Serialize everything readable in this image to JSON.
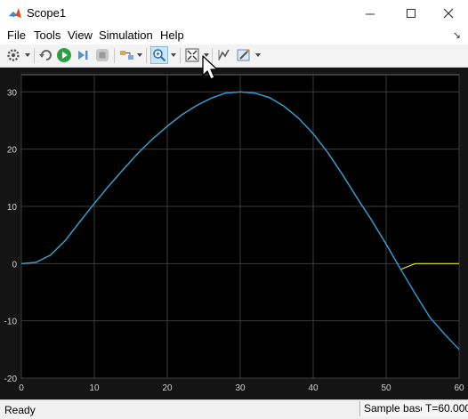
{
  "window": {
    "title": "Scope1"
  },
  "menu": [
    "File",
    "Tools",
    "View",
    "Simulation",
    "Help"
  ],
  "toolbar_icons": [
    "gear-icon",
    "restore-icon",
    "run-icon",
    "step-forward-icon",
    "stop-icon",
    "highlight-block-icon",
    "zoom-in-icon",
    "zoom-fit-icon",
    "cursor-measure-icon",
    "style-icon"
  ],
  "status": {
    "ready": "Ready",
    "sample_mode": "Sample based",
    "time": "T=60.000"
  },
  "colors": {
    "plot_bg": "#000000",
    "frame_bg": "#141414",
    "grid": "#3c3c3c",
    "axis_text": "#d0d0d0",
    "signal_blue": "#2f9bd6",
    "signal_yellow": "#e6e619"
  },
  "chart_data": {
    "type": "line",
    "xlim": [
      0,
      60
    ],
    "ylim": [
      -20,
      33
    ],
    "xticks": [
      0,
      10,
      20,
      30,
      40,
      50,
      60
    ],
    "yticks": [
      -20,
      -10,
      0,
      10,
      20,
      30
    ],
    "grid": true,
    "series": [
      {
        "color": "#2f9bd6",
        "x": [
          0,
          2,
          4,
          6,
          8,
          10,
          12,
          14,
          16,
          18,
          20,
          22,
          24,
          26,
          28,
          30,
          32,
          34,
          36,
          38,
          40,
          42,
          44,
          46,
          48,
          50,
          52,
          54,
          56,
          58,
          60
        ],
        "y": [
          0,
          0.2,
          1.5,
          4,
          7.3,
          10.5,
          13.6,
          16.5,
          19.3,
          21.8,
          24,
          26,
          27.6,
          28.9,
          29.8,
          30,
          29.8,
          29,
          27.5,
          25.4,
          22.7,
          19.4,
          15.6,
          11.5,
          7.6,
          3.4,
          -1,
          -5.3,
          -9.4,
          -12.3,
          -15
        ]
      },
      {
        "color": "#e6e619",
        "x": [
          0,
          2,
          4,
          6,
          8,
          10,
          12,
          14,
          16,
          18,
          20,
          22,
          24,
          26,
          28,
          30,
          32,
          34,
          36,
          38,
          40,
          42,
          44,
          46,
          48,
          50,
          52,
          54,
          54.5,
          60
        ],
        "y": [
          0,
          0.2,
          1.5,
          4,
          7.3,
          10.5,
          13.6,
          16.5,
          19.3,
          21.8,
          24,
          26,
          27.6,
          28.9,
          29.8,
          30,
          29.8,
          29,
          27.5,
          25.4,
          22.7,
          19.4,
          15.6,
          11.5,
          7.6,
          3.4,
          -1,
          0,
          0,
          0
        ]
      }
    ]
  }
}
